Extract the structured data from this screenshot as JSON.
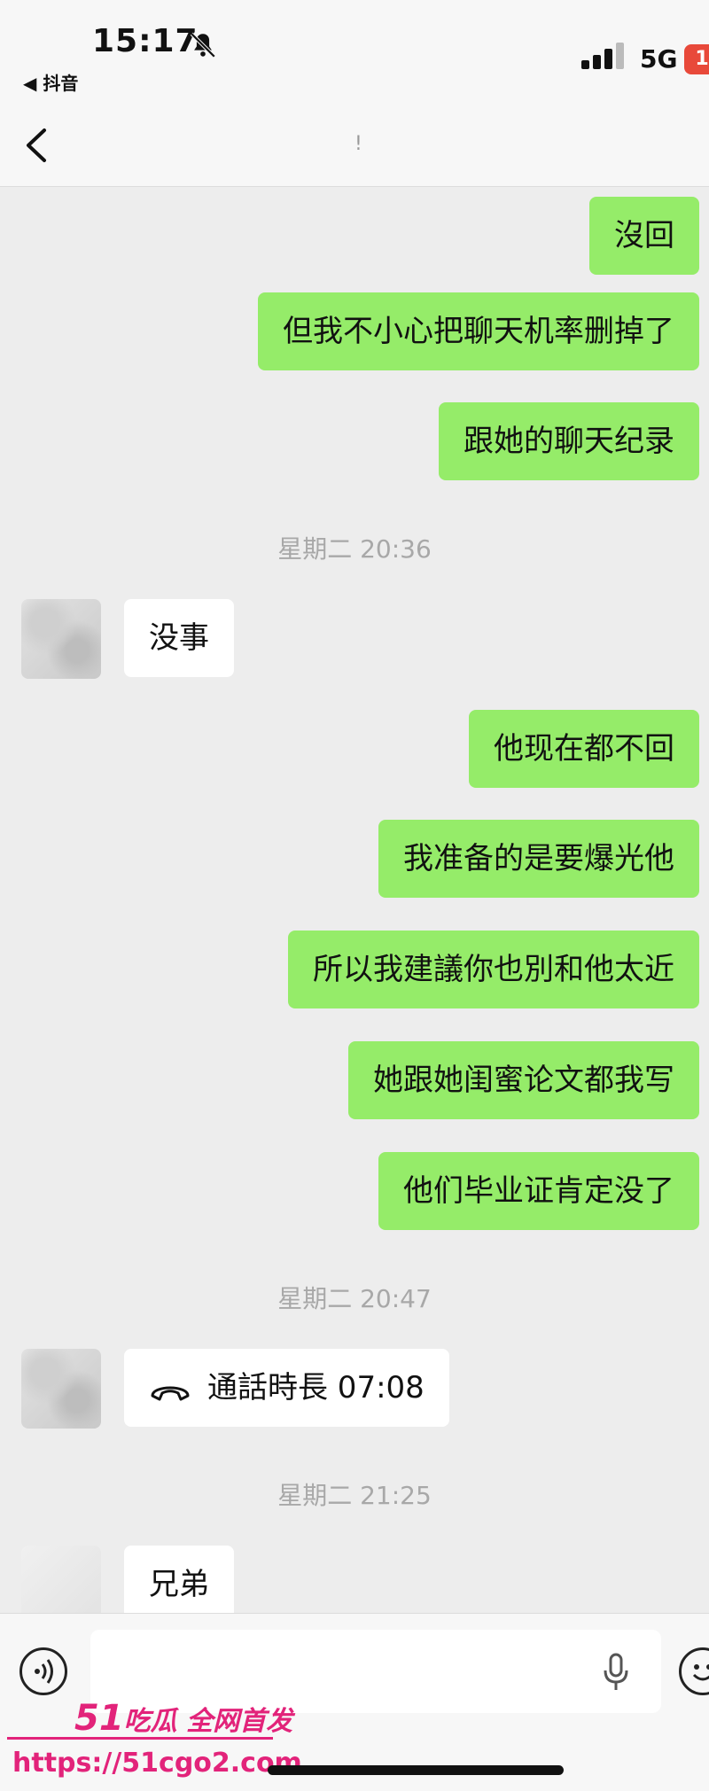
{
  "status_bar": {
    "time": "15:17",
    "back_app": "◀ 抖音",
    "network": "5G",
    "battery": "1"
  },
  "nav": {
    "title": "!"
  },
  "messages": [
    {
      "dir": "out",
      "text": "沒回"
    },
    {
      "dir": "out",
      "text": "但我不小心把聊天机率删掉了"
    },
    {
      "dir": "out",
      "text": "跟她的聊天纪录"
    },
    {
      "type": "timestamp",
      "text": "星期二 20:36"
    },
    {
      "dir": "in",
      "text": "没事"
    },
    {
      "dir": "out",
      "text": "他现在都不回"
    },
    {
      "dir": "out",
      "text": "我准备的是要爆光他"
    },
    {
      "dir": "out",
      "text": "所以我建議你也別和他太近"
    },
    {
      "dir": "out",
      "text": "她跟她闺蜜论文都我写"
    },
    {
      "dir": "out",
      "text": "他们毕业证肯定没了"
    },
    {
      "type": "timestamp",
      "text": "星期二 20:47"
    },
    {
      "dir": "in",
      "type": "call",
      "text": "通話時長 07:08"
    },
    {
      "type": "timestamp",
      "text": "星期二 21:25"
    },
    {
      "dir": "in",
      "text": "兄弟"
    }
  ],
  "input": {
    "placeholder": ""
  },
  "watermark": {
    "number": "51",
    "title": "吃瓜 全网首发",
    "url": "https://51cgo2.com"
  },
  "colors": {
    "outgoing_bubble": "#95ec69",
    "incoming_bubble": "#ffffff",
    "background": "#ededed",
    "watermark": "#e2237a"
  }
}
